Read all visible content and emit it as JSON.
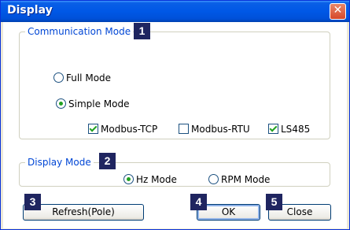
{
  "window": {
    "title": "Display",
    "close_symbol": "✕"
  },
  "communication": {
    "group_label": "Communication Mode",
    "badge": "1",
    "full_mode": {
      "label": "Full Mode",
      "selected": false
    },
    "simple_mode": {
      "label": "Simple Mode",
      "selected": true
    },
    "modbus_tcp": {
      "label": "Modbus-TCP",
      "checked": true
    },
    "modbus_rtu": {
      "label": "Modbus-RTU",
      "checked": false
    },
    "ls485": {
      "label": "LS485",
      "checked": true
    }
  },
  "display": {
    "group_label": "Display Mode",
    "badge": "2",
    "hz_mode": {
      "label": "Hz Mode",
      "selected": true
    },
    "rpm_mode": {
      "label": "RPM Mode",
      "selected": false
    }
  },
  "buttons": {
    "refresh": {
      "label": "Refresh(Pole)",
      "badge": "3"
    },
    "ok": {
      "label": "OK",
      "badge": "4"
    },
    "close": {
      "label": "Close",
      "badge": "5"
    }
  },
  "colors": {
    "title_bar": "#0058e6",
    "group_label": "#0046d5",
    "badge_bg": "#1f2560",
    "check_mark": "#21a121"
  }
}
